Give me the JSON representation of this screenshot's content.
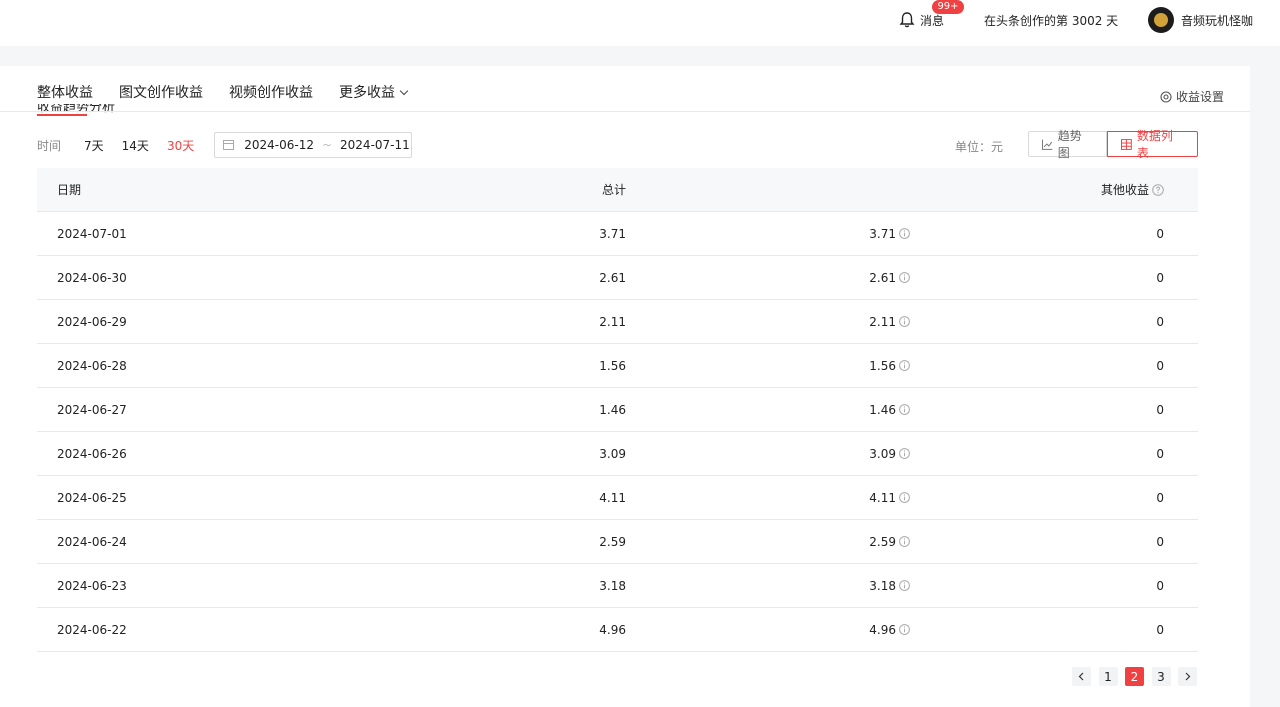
{
  "header": {
    "messages_label": "消息",
    "messages_badge": "99+",
    "days_text": "在头条创作的第 3002 天",
    "user_name": "音频玩机怪咖"
  },
  "tabs": [
    {
      "label": "整体收益",
      "active": true
    },
    {
      "label": "图文创作收益",
      "active": false
    },
    {
      "label": "视频创作收益",
      "active": false
    },
    {
      "label": "更多收益",
      "active": false
    }
  ],
  "settings_label": "收益设置",
  "section_title": "收益趋势分析",
  "filters": {
    "time_label": "时间",
    "options": [
      "7天",
      "14天",
      "30天"
    ],
    "active_option": "30天",
    "start_date": "2024-06-12",
    "end_date": "2024-07-11",
    "separator": "~"
  },
  "unit_label": "单位：元",
  "view_buttons": {
    "trend": "趋势图",
    "list": "数据列表"
  },
  "table": {
    "columns": [
      "日期",
      "总计",
      "",
      "其他收益"
    ],
    "rows": [
      {
        "date": "2024-07-01",
        "total": "3.71",
        "mid": "3.71",
        "other": "0"
      },
      {
        "date": "2024-06-30",
        "total": "2.61",
        "mid": "2.61",
        "other": "0"
      },
      {
        "date": "2024-06-29",
        "total": "2.11",
        "mid": "2.11",
        "other": "0"
      },
      {
        "date": "2024-06-28",
        "total": "1.56",
        "mid": "1.56",
        "other": "0"
      },
      {
        "date": "2024-06-27",
        "total": "1.46",
        "mid": "1.46",
        "other": "0"
      },
      {
        "date": "2024-06-26",
        "total": "3.09",
        "mid": "3.09",
        "other": "0"
      },
      {
        "date": "2024-06-25",
        "total": "4.11",
        "mid": "4.11",
        "other": "0"
      },
      {
        "date": "2024-06-24",
        "total": "2.59",
        "mid": "2.59",
        "other": "0"
      },
      {
        "date": "2024-06-23",
        "total": "3.18",
        "mid": "3.18",
        "other": "0"
      },
      {
        "date": "2024-06-22",
        "total": "4.96",
        "mid": "4.96",
        "other": "0"
      }
    ]
  },
  "pagination": {
    "pages": [
      "1",
      "2",
      "3"
    ],
    "current": "2"
  },
  "colors": {
    "accent": "#f04142",
    "border": "#e8e8e8",
    "header_bg": "#f7f8fa"
  }
}
